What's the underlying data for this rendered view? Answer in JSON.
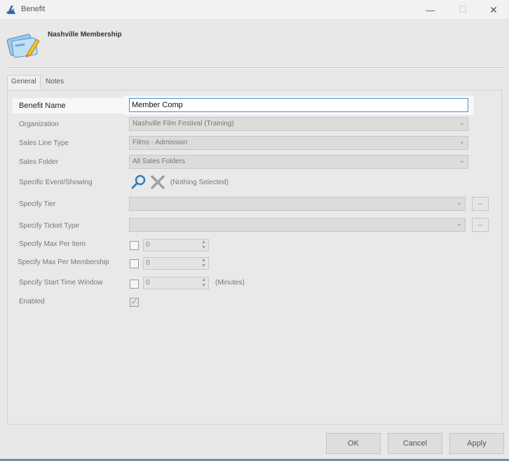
{
  "window": {
    "title": "Benefit",
    "minimize_glyph": "—",
    "maximize_glyph": "☐",
    "close_glyph": "✕"
  },
  "header": {
    "title": "Nashville Membership",
    "icon": "membership-card-icon"
  },
  "tabs": [
    {
      "label": "General",
      "active": true
    },
    {
      "label": "Notes",
      "active": false
    }
  ],
  "form": {
    "benefit_name": {
      "label": "Benefit Name",
      "value": "Member Comp"
    },
    "organization": {
      "label": "Organization",
      "value": "Nashville Film Festival (Training)"
    },
    "sales_line_type": {
      "label": "Sales Line Type",
      "value": "Films - Admission"
    },
    "sales_folder": {
      "label": "Sales Folder",
      "value": "All Sales Folders"
    },
    "specific_event": {
      "label": "Specific Event/Showing",
      "value": "(Nothing Selected)"
    },
    "specify_tier": {
      "label": "Specify Tier",
      "value": "",
      "button": "..."
    },
    "specify_ticket_type": {
      "label": "Specify Ticket Type",
      "value": "",
      "button": "..."
    },
    "max_per_item": {
      "label": "Specify Max Per Item",
      "checked": false,
      "value": "0"
    },
    "max_per_membership": {
      "label": "Specify Max Per Membership",
      "checked": false,
      "value": "0"
    },
    "start_time_window": {
      "label": "Specify Start Time Window",
      "checked": false,
      "value": "0",
      "unit": "(Minutes)"
    },
    "enabled": {
      "label": "Enabled",
      "checked": true
    }
  },
  "buttons": {
    "ok": "OK",
    "cancel": "Cancel",
    "apply": "Apply"
  },
  "colors": {
    "accent": "#4a90d9",
    "logo": "#2f6db5",
    "dialog_bg": "#e8e8e8"
  }
}
